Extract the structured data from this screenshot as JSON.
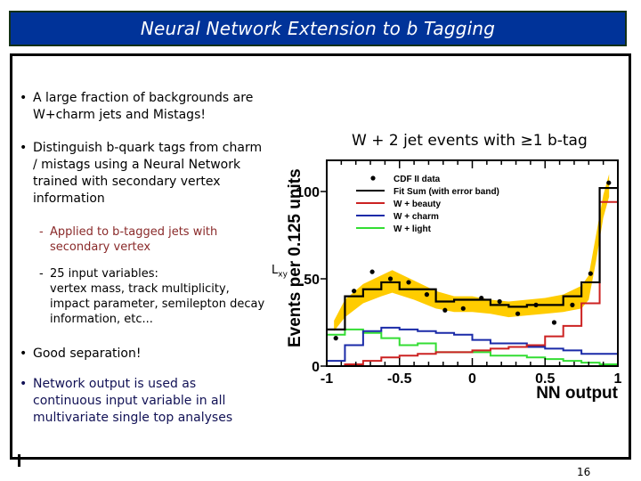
{
  "slide": {
    "title": "Neural Network Extension to b Tagging",
    "page_number": "16",
    "bullets": [
      {
        "lines": [
          "A large fraction of backgrounds are",
          "W+charm jets and Mistags!"
        ]
      },
      {
        "lines": [
          "Distinguish b-quark tags from charm",
          "/ mistags using a Neural Network",
          "trained with secondary vertex",
          "information"
        ]
      },
      {
        "lines": [
          "Good separation!"
        ]
      },
      {
        "lines": [
          "Network output is used as",
          "continuous input variable in all",
          "multivariate single top analyses"
        ]
      }
    ],
    "sub_bullets": [
      {
        "lines": [
          "Applied to b-tagged jets with",
          "secondary vertex"
        ]
      },
      {
        "lines": [
          "25 input variables:",
          "vertex mass, track multiplicity,",
          "impact parameter, semilepton decay",
          "information, etc..."
        ]
      }
    ],
    "annotation": {
      "main": "L",
      "sub": "xy"
    },
    "bullet_glyph": "•",
    "dash_glyph": "-"
  },
  "chart_data": {
    "type": "bar",
    "title": "W + 2 jet events with ≥1 b-tag",
    "xlabel": "NN output",
    "ylabel": "Events per 0.125 units",
    "xlim": [
      -1,
      1
    ],
    "ylim": [
      0,
      113
    ],
    "xticks": [
      "-1",
      "-0.5",
      "0",
      "0.5",
      "1"
    ],
    "xtick_values": [
      -1,
      -0.5,
      0,
      0.5,
      1
    ],
    "yticks": [
      "0",
      "50",
      "100"
    ],
    "ytick_values": [
      0,
      50,
      100
    ],
    "bin_edges": [
      -1,
      -0.875,
      -0.75,
      -0.625,
      -0.5,
      -0.375,
      -0.25,
      -0.125,
      0,
      0.125,
      0.25,
      0.375,
      0.5,
      0.625,
      0.75,
      0.875,
      1
    ],
    "legend": {
      "placement": "top-left",
      "entries": [
        {
          "label": "CDF II data",
          "marker": "dot",
          "color": "#000000"
        },
        {
          "label": "Fit Sum (with error band)",
          "marker": "line",
          "color": "#000000"
        },
        {
          "label": "W + beauty",
          "marker": "line",
          "color": "#cc2222"
        },
        {
          "label": "W + charm",
          "marker": "line",
          "color": "#1a2aa8"
        },
        {
          "label": "W + light",
          "marker": "line",
          "color": "#33dd33"
        }
      ]
    },
    "series": [
      {
        "name": "Fit Sum",
        "kind": "step",
        "color": "#000000",
        "values": [
          21,
          40,
          44,
          48,
          44,
          44,
          37,
          38,
          38,
          35,
          34,
          35,
          35,
          40,
          48,
          102
        ]
      },
      {
        "name": "W + beauty",
        "kind": "step",
        "color": "#cc2222",
        "values": [
          0,
          1,
          3,
          5,
          6,
          7,
          8,
          8,
          9,
          10,
          11,
          12,
          17,
          23,
          36,
          94
        ]
      },
      {
        "name": "W + charm",
        "kind": "step",
        "color": "#1a2aa8",
        "values": [
          3,
          12,
          20,
          22,
          21,
          20,
          19,
          18,
          15,
          13,
          13,
          11,
          10,
          9,
          7,
          7
        ]
      },
      {
        "name": "W + light",
        "kind": "step",
        "color": "#33dd33",
        "values": [
          18,
          21,
          19,
          16,
          12,
          13,
          8,
          8,
          8,
          6,
          6,
          5,
          4,
          3,
          2,
          1
        ]
      },
      {
        "name": "CDF II data",
        "kind": "points",
        "color": "#000000",
        "x": [
          -0.9375,
          -0.8125,
          -0.6875,
          -0.5625,
          -0.4375,
          -0.3125,
          -0.1875,
          -0.0625,
          0.0625,
          0.1875,
          0.3125,
          0.4375,
          0.5625,
          0.6875,
          0.8125,
          0.9375
        ],
        "values": [
          16,
          43,
          54,
          50,
          48,
          41,
          32,
          33,
          39,
          37,
          30,
          35,
          25,
          35,
          53,
          105
        ]
      },
      {
        "name": "Error band",
        "kind": "band",
        "color": "#ffcc00",
        "x": [
          -0.95,
          -0.875,
          -0.75,
          -0.625,
          -0.55,
          -0.4,
          -0.25,
          -0.125,
          0,
          0.125,
          0.25,
          0.375,
          0.5,
          0.625,
          0.75,
          0.8,
          0.85,
          0.9,
          0.94
        ],
        "lower": [
          20,
          28,
          36,
          40,
          42,
          38,
          33,
          31,
          31,
          30,
          28,
          29,
          30,
          31,
          33,
          38,
          60,
          85,
          97
        ],
        "upper": [
          26,
          38,
          47,
          52,
          55,
          49,
          43,
          40,
          40,
          38,
          37,
          38,
          39,
          41,
          46,
          52,
          75,
          98,
          110
        ]
      }
    ]
  }
}
